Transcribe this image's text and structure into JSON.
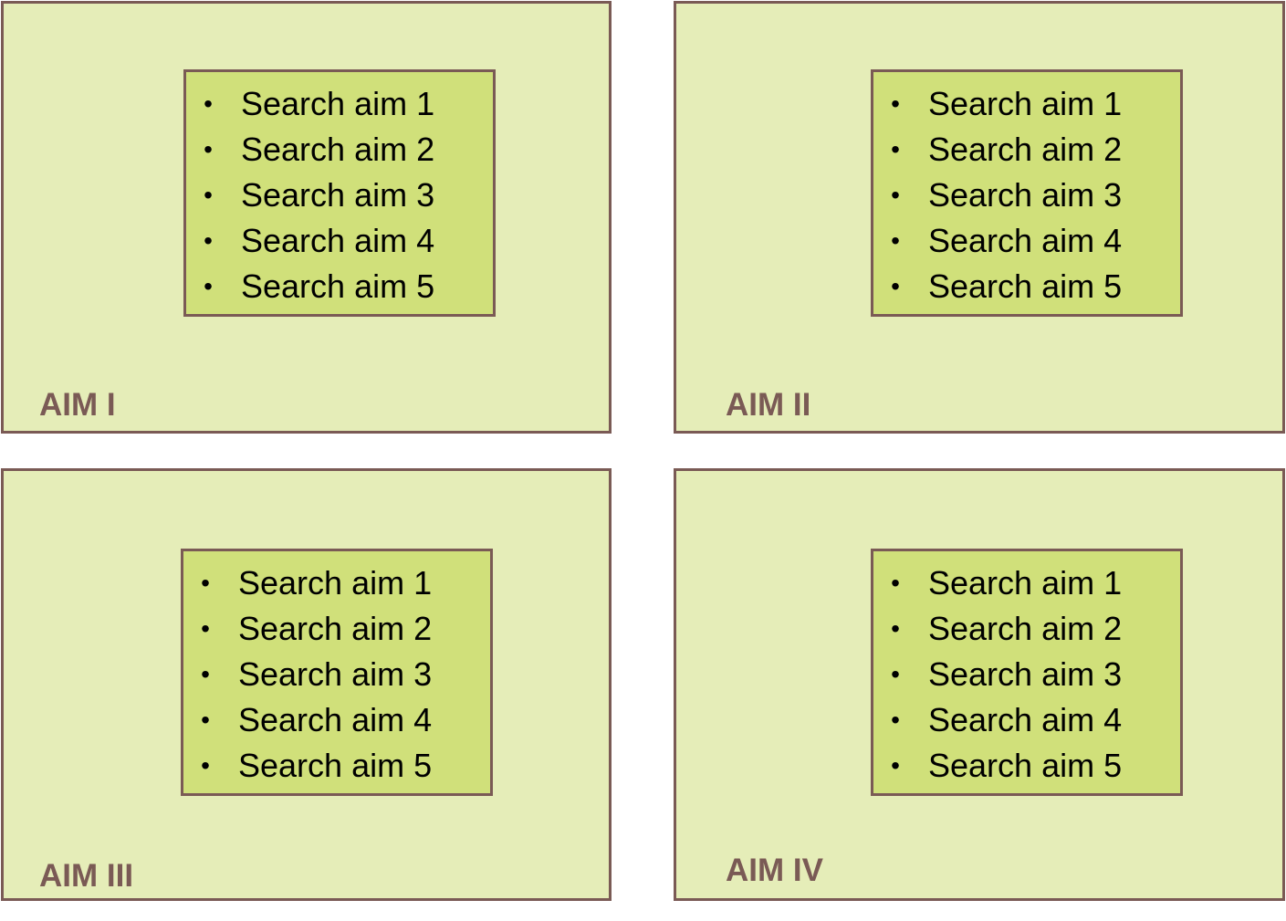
{
  "panels": [
    {
      "label": "AIM I",
      "items": [
        "Search aim 1",
        "Search aim 2",
        "Search aim 3",
        "Search aim 4",
        "Search aim 5"
      ]
    },
    {
      "label": "AIM II",
      "items": [
        "Search aim 1",
        "Search aim 2",
        "Search aim 3",
        "Search aim 4",
        "Search aim 5"
      ]
    },
    {
      "label": "AIM III",
      "items": [
        "Search aim 1",
        "Search aim 2",
        "Search aim 3",
        "Search aim 4",
        "Search aim 5"
      ]
    },
    {
      "label": "AIM IV",
      "items": [
        "Search aim 1",
        "Search aim 2",
        "Search aim 3",
        "Search aim 4",
        "Search aim 5"
      ]
    }
  ],
  "bullet_glyph": "•",
  "colors": {
    "outer_fill": "#e5edb8",
    "inner_fill": "#d0e07a",
    "border": "#7a5a55",
    "label": "#7a5a55"
  }
}
